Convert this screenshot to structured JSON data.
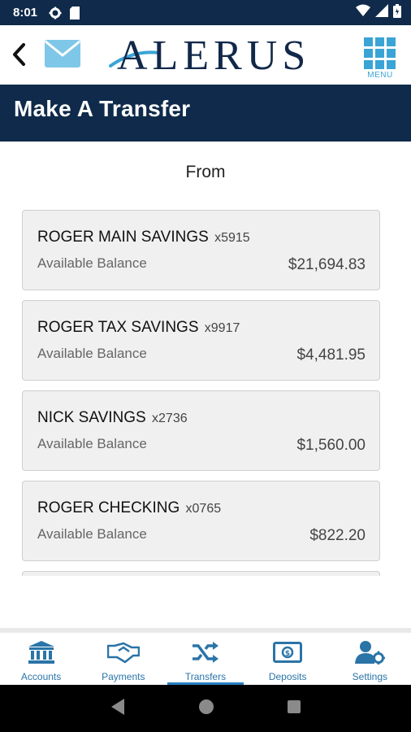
{
  "status_bar": {
    "time": "8:01",
    "icons": [
      "gear-icon",
      "sd-card-icon",
      "wifi-icon",
      "signal-icon",
      "battery-icon"
    ]
  },
  "header": {
    "logo_text": "ALERUS",
    "menu_label": "MENU",
    "icons": [
      "back-arrow-icon",
      "mail-icon",
      "menu-grid-icon"
    ]
  },
  "page": {
    "title": "Make A Transfer",
    "from_label": "From"
  },
  "accounts": [
    {
      "name": "ROGER MAIN SAVINGS",
      "number": "x5915",
      "balance_label": "Available Balance",
      "balance": "$21,694.83"
    },
    {
      "name": "ROGER TAX SAVINGS",
      "number": "x9917",
      "balance_label": "Available Balance",
      "balance": "$4,481.95"
    },
    {
      "name": "NICK SAVINGS",
      "number": "x2736",
      "balance_label": "Available Balance",
      "balance": "$1,560.00"
    },
    {
      "name": "ROGER CHECKING",
      "number": "x0765",
      "balance_label": "Available Balance",
      "balance": "$822.20"
    }
  ],
  "bottom_nav": {
    "tabs": [
      {
        "label": "Accounts",
        "icon": "bank-icon"
      },
      {
        "label": "Payments",
        "icon": "handshake-icon"
      },
      {
        "label": "Transfers",
        "icon": "shuffle-icon",
        "active": true
      },
      {
        "label": "Deposits",
        "icon": "check-deposit-icon"
      },
      {
        "label": "Settings",
        "icon": "user-settings-icon"
      }
    ]
  },
  "colors": {
    "navy": "#0f2a4a",
    "accent_blue": "#3aa4d6",
    "nav_blue": "#2a74a8"
  }
}
